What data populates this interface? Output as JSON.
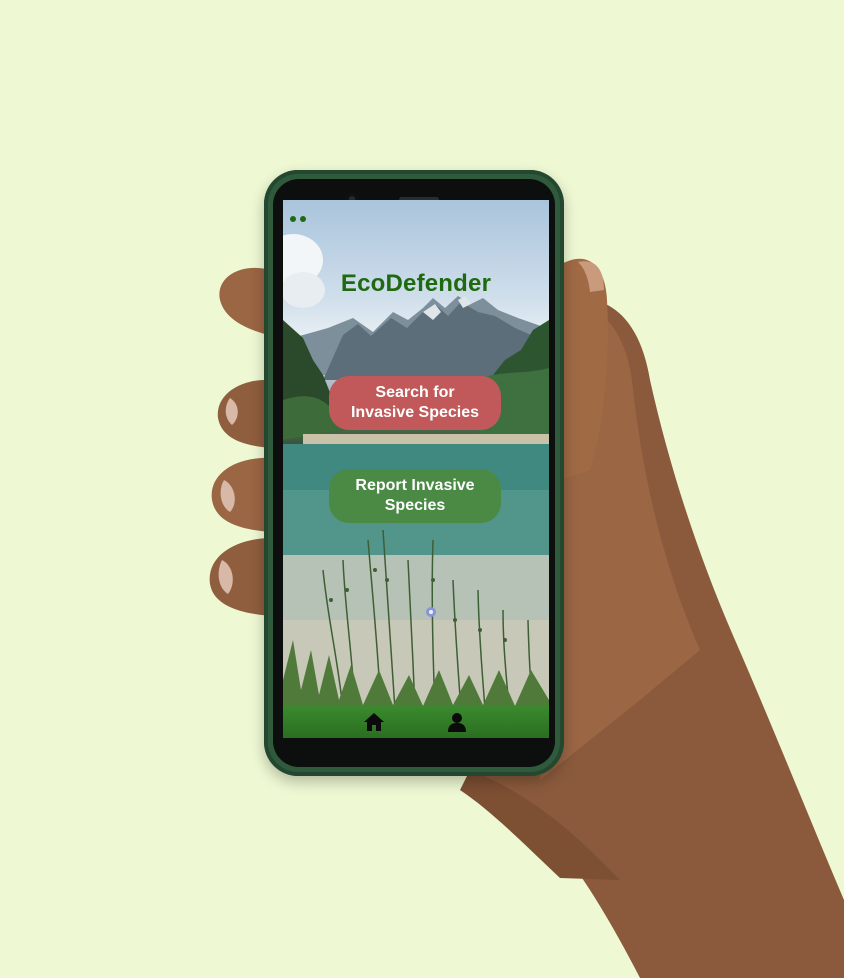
{
  "app": {
    "title": "EcoDefender",
    "accent_color": "#1f6a10"
  },
  "actions": {
    "search_label_line1": "Search for",
    "search_label_line2": "Invasive Species",
    "search_color": "#c1595a",
    "report_label_line1": "Report Invasive",
    "report_label_line2": "Species",
    "report_color": "#4a8a45"
  },
  "nav": {
    "items": [
      {
        "icon": "home-icon"
      },
      {
        "icon": "user-icon"
      }
    ]
  }
}
